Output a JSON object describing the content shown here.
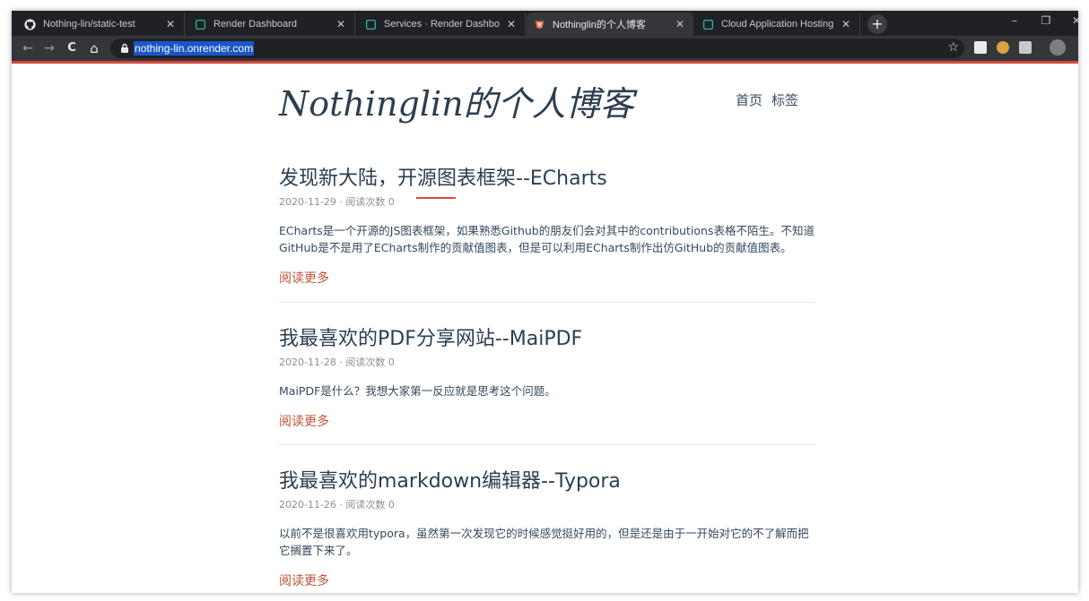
{
  "browser": {
    "tabs": [
      {
        "title": "Nothing-lin/static-test",
        "icon": "github-icon",
        "active": false
      },
      {
        "title": "Render Dashboard",
        "icon": "render-icon",
        "active": false
      },
      {
        "title": "Services · Render Dashboard",
        "icon": "render-icon",
        "active": false
      },
      {
        "title": "Nothinglin的个人博客",
        "icon": "blog-favicon-icon",
        "active": true
      },
      {
        "title": "Cloud Application Hosting for",
        "icon": "render-icon",
        "active": false
      }
    ],
    "new_tab_label": "+",
    "minimize_label": "–",
    "restore_label": "❐",
    "close_label": "✕",
    "tab_close_label": "✕",
    "back_label": "←",
    "forward_label": "→",
    "reload_label": "C",
    "home_label": "⌂",
    "url": "nothing-lin.onrender.com",
    "bookmark_label": "☆",
    "accent_color": "#d9453a"
  },
  "site": {
    "logo": "Nothinglin的个人博客",
    "nav": [
      "首页",
      "标签"
    ]
  },
  "posts": [
    {
      "title": "发现新大陆，开源图表框架--ECharts",
      "meta": "2020-11-29 · 阅读次数 0",
      "summary": "ECharts是一个开源的JS图表框架，如果熟悉Github的朋友们会对其中的contributions表格不陌生。不知道GitHub是不是用了ECharts制作的贡献值图表，但是可以利用ECharts制作出仿GitHub的贡献值图表。",
      "more": "阅读更多"
    },
    {
      "title": "我最喜欢的PDF分享网站--MaiPDF",
      "meta": "2020-11-28 · 阅读次数 0",
      "summary": "MaiPDF是什么？我想大家第一反应就是思考这个问题。",
      "more": "阅读更多"
    },
    {
      "title": "我最喜欢的markdown编辑器--Typora",
      "meta": "2020-11-26 · 阅读次数 0",
      "summary": "以前不是很喜欢用typora，虽然第一次发现它的时候感觉挺好用的，但是还是由于一开始对它的不了解而把它搁置下来了。",
      "more": "阅读更多"
    }
  ]
}
